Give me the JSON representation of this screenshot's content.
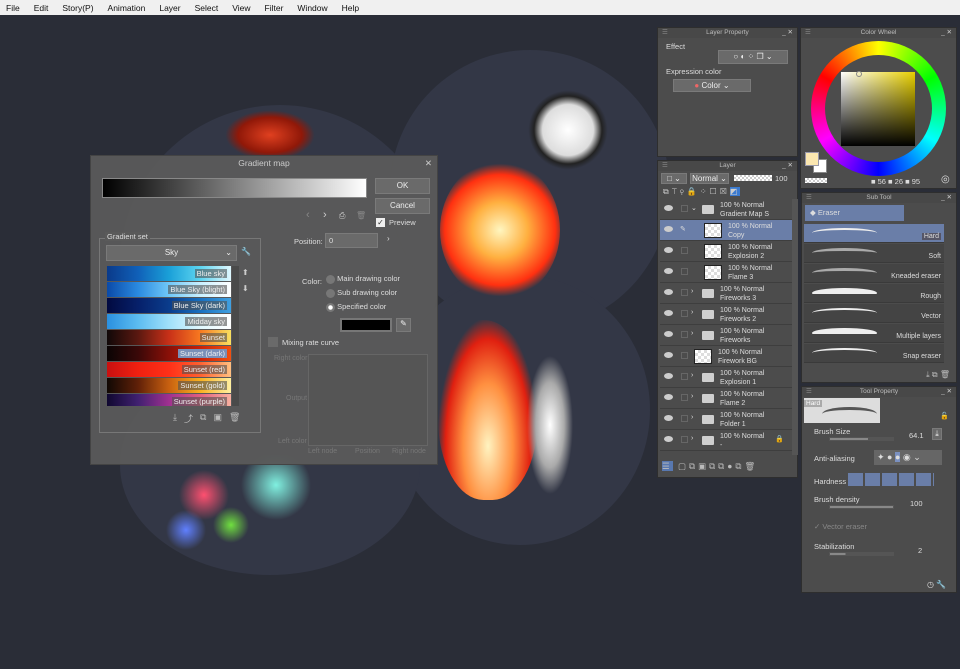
{
  "menu": [
    "File",
    "Edit",
    "Story(P)",
    "Animation",
    "Layer",
    "Select",
    "View",
    "Filter",
    "Window",
    "Help"
  ],
  "dialog": {
    "title": "Gradient map",
    "ok": "OK",
    "cancel": "Cancel",
    "preview": "Preview",
    "gradient_set_label": "Gradient set",
    "set_selected": "Sky",
    "position_label": "Position:",
    "position_value": "0",
    "color_label": "Color:",
    "color_options": [
      "Main drawing color",
      "Sub drawing color",
      "Specified color"
    ],
    "mixing": "Mixing rate curve",
    "right_color": "Right color",
    "output": "Output",
    "left_color": "Left color",
    "left_node": "Left node",
    "position": "Position",
    "right_node": "Right node",
    "gradients": [
      {
        "name": "Blue sky",
        "colors": "#0a3a8a,#1060b8,#1aa0d8,#5cd4f0,#e0f8ff"
      },
      {
        "name": "Blue Sky (blight)",
        "colors": "#0b4aa8,#2a8ae0,#70c8f8,#c8f0ff,#ffffff"
      },
      {
        "name": "Blue Sky (dark)",
        "colors": "#020a40,#06206a,#0a3c8c,#1870c0,#40a0e0"
      },
      {
        "name": "Midday sky",
        "colors": "#2a90e0,#5cbcf0,#a0e0fa,#e0f8ff,#ffffff"
      },
      {
        "name": "Sunset",
        "colors": "#100808,#5a1810,#c83018,#f87820,#f8e060"
      },
      {
        "name": "Sunset (dark)",
        "colors": "#0a0404,#3a0808,#8a1008,#c82008,#f05010"
      },
      {
        "name": "Sunset (red)",
        "colors": "#c81010,#f02010,#ff3018,#ff6030,#ffc080"
      },
      {
        "name": "Sunset (gold)",
        "colors": "#100804,#602008,#c86010,#f8b020,#fff0a0"
      },
      {
        "name": "Sunset (purple)",
        "colors": "#100830,#402070,#a03090,#e06080,#f8b0a0"
      }
    ]
  },
  "layer_property": {
    "title": "Layer Property",
    "effect": "Effect",
    "expression_color": "Expression color",
    "color_value": "Color"
  },
  "color_wheel": {
    "title": "Color Wheel",
    "h": "56",
    "s": "26",
    "v": "95",
    "main_color": "#fbe7b0"
  },
  "layer_panel": {
    "title": "Layer",
    "blend": "Normal",
    "opacity": "100",
    "layers": [
      {
        "mode": "100 % Normal",
        "name": "Gradient Map S",
        "type": "folder-open",
        "indent": 0
      },
      {
        "mode": "100 % Normal",
        "name": "Copy",
        "type": "raster",
        "indent": 1,
        "selected": true
      },
      {
        "mode": "100 % Normal",
        "name": "Explosion 2",
        "type": "raster",
        "indent": 1
      },
      {
        "mode": "100 % Normal",
        "name": "Flame 3",
        "type": "raster",
        "indent": 1
      },
      {
        "mode": "100 % Normal",
        "name": "Fireworks 3",
        "type": "folder",
        "indent": 0
      },
      {
        "mode": "100 % Normal",
        "name": "Fireworks 2",
        "type": "folder",
        "indent": 0
      },
      {
        "mode": "100 % Normal",
        "name": "Fireworks",
        "type": "folder",
        "indent": 0
      },
      {
        "mode": "100 % Normal",
        "name": "Firework BG",
        "type": "raster",
        "indent": -1
      },
      {
        "mode": "100 % Normal",
        "name": "Explosion 1",
        "type": "folder",
        "indent": 0
      },
      {
        "mode": "100 % Normal",
        "name": "Flame 2",
        "type": "folder",
        "indent": 0
      },
      {
        "mode": "100 % Normal",
        "name": "Folder 1",
        "type": "folder",
        "indent": 0
      },
      {
        "mode": "100 % Normal",
        "name": "-",
        "type": "folder",
        "indent": 0
      }
    ]
  },
  "sub_tool": {
    "title": "Sub Tool",
    "group": "Eraser",
    "items": [
      "Hard",
      "Soft",
      "Kneaded eraser",
      "Rough",
      "Vector",
      "Multiple layers",
      "Snap eraser"
    ]
  },
  "tool_property": {
    "title": "Tool Property",
    "preview_label": "Hard",
    "brush_size_label": "Brush Size",
    "brush_size": "64.1",
    "anti_aliasing": "Anti-aliasing",
    "hardness": "Hardness",
    "brush_density_label": "Brush density",
    "brush_density": "100",
    "vector_eraser": "Vector eraser",
    "stabilization_label": "Stabilization",
    "stabilization": "2"
  }
}
